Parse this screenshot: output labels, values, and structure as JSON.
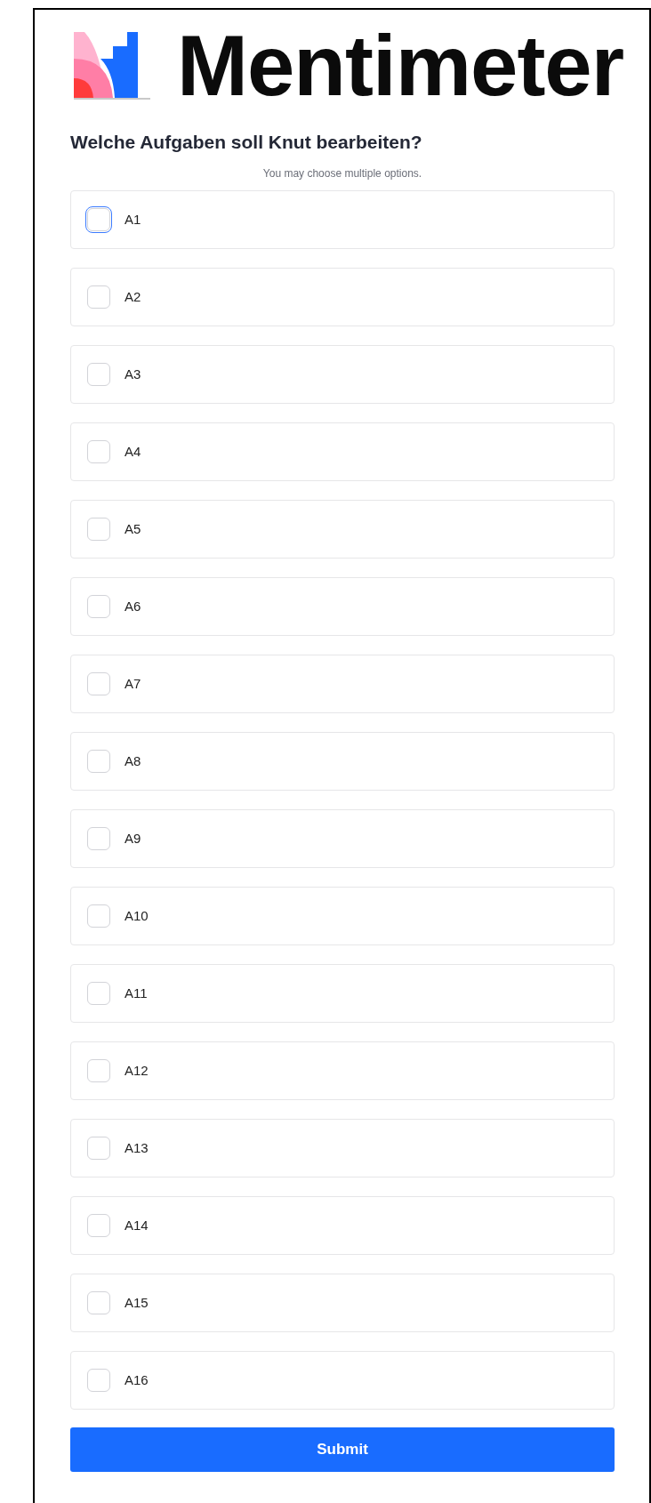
{
  "logo": {
    "text": "Mentimeter"
  },
  "question": "Welche Aufgaben soll Knut bearbeiten?",
  "hint": "You may choose multiple options.",
  "options": [
    {
      "label": "A1",
      "checked": false,
      "focused": true
    },
    {
      "label": "A2",
      "checked": false,
      "focused": false
    },
    {
      "label": "A3",
      "checked": false,
      "focused": false
    },
    {
      "label": "A4",
      "checked": false,
      "focused": false
    },
    {
      "label": "A5",
      "checked": false,
      "focused": false
    },
    {
      "label": "A6",
      "checked": false,
      "focused": false
    },
    {
      "label": "A7",
      "checked": false,
      "focused": false
    },
    {
      "label": "A8",
      "checked": false,
      "focused": false
    },
    {
      "label": "A9",
      "checked": false,
      "focused": false
    },
    {
      "label": "A10",
      "checked": false,
      "focused": false
    },
    {
      "label": "A11",
      "checked": false,
      "focused": false
    },
    {
      "label": "A12",
      "checked": false,
      "focused": false
    },
    {
      "label": "A13",
      "checked": false,
      "focused": false
    },
    {
      "label": "A14",
      "checked": false,
      "focused": false
    },
    {
      "label": "A15",
      "checked": false,
      "focused": false
    },
    {
      "label": "A16",
      "checked": false,
      "focused": false
    }
  ],
  "submit": "Submit"
}
